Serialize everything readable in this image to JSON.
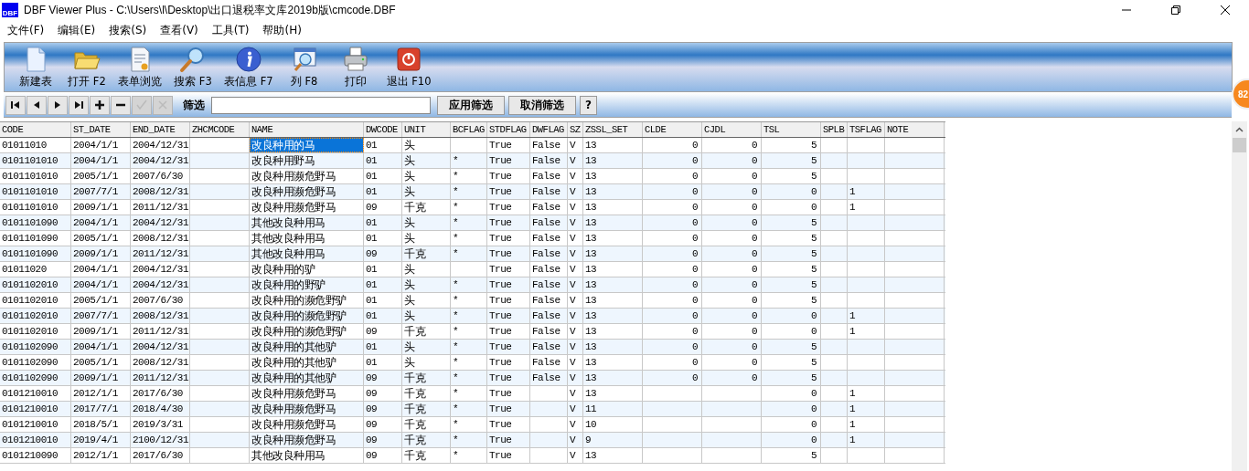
{
  "window": {
    "icon_text": "DBF",
    "title": "DBF Viewer Plus - C:\\Users\\l\\Desktop\\出口退税率文库2019b版\\cmcode.DBF"
  },
  "menu": [
    "文件(F)",
    "编辑(E)",
    "搜索(S)",
    "查看(V)",
    "工具(T)",
    "帮助(H)"
  ],
  "toolbar": [
    "新建表",
    "打开 F2",
    "表单浏览",
    "搜索 F3",
    "表信息 F7",
    "列 F8",
    "打印",
    "退出 F10"
  ],
  "navigator": [
    {
      "disabled": false
    },
    {
      "disabled": false
    },
    {
      "disabled": false
    },
    {
      "disabled": false
    },
    {
      "disabled": false
    },
    {
      "disabled": false
    },
    {
      "disabled": true
    },
    {
      "disabled": true
    }
  ],
  "filter": {
    "label": "筛选",
    "apply": "应用筛选",
    "clear": "取消筛选",
    "help": "?"
  },
  "badge": "82",
  "table": {
    "columns": [
      {
        "name": "CODE",
        "kind": "text"
      },
      {
        "name": "ST_DATE",
        "kind": "text"
      },
      {
        "name": "END_DATE",
        "kind": "text"
      },
      {
        "name": "ZHCMCODE",
        "kind": "text"
      },
      {
        "name": "NAME",
        "kind": "text"
      },
      {
        "name": "DWCODE",
        "kind": "text"
      },
      {
        "name": "UNIT",
        "kind": "text"
      },
      {
        "name": "BCFLAG",
        "kind": "text"
      },
      {
        "name": "STDFLAG",
        "kind": "text"
      },
      {
        "name": "DWFLAG",
        "kind": "text"
      },
      {
        "name": "SZ",
        "kind": "text"
      },
      {
        "name": "ZSSL_SET",
        "kind": "text"
      },
      {
        "name": "CLDE",
        "kind": "number"
      },
      {
        "name": "CJDL",
        "kind": "number"
      },
      {
        "name": "TSL",
        "kind": "number"
      },
      {
        "name": "SPLB",
        "kind": "text"
      },
      {
        "name": "TSFLAG",
        "kind": "text"
      },
      {
        "name": "NOTE",
        "kind": "text"
      }
    ],
    "rows": [
      {
        "selected": true,
        "cells": [
          "01011010",
          "2004/1/1",
          "2004/12/31",
          null,
          "改良种用的马",
          "01",
          "头",
          null,
          "True",
          "False",
          "V",
          "13",
          "0",
          "0",
          "5",
          null,
          null,
          null
        ]
      },
      {
        "selected": false,
        "cells": [
          "0101101010",
          "2004/1/1",
          "2004/12/31",
          null,
          "改良种用野马",
          "01",
          "头",
          "*",
          "True",
          "False",
          "V",
          "13",
          "0",
          "0",
          "5",
          null,
          null,
          null
        ]
      },
      {
        "selected": false,
        "cells": [
          "0101101010",
          "2005/1/1",
          "2007/6/30",
          null,
          "改良种用濒危野马",
          "01",
          "头",
          "*",
          "True",
          "False",
          "V",
          "13",
          "0",
          "0",
          "5",
          null,
          null,
          null
        ]
      },
      {
        "selected": false,
        "cells": [
          "0101101010",
          "2007/7/1",
          "2008/12/31",
          null,
          "改良种用濒危野马",
          "01",
          "头",
          "*",
          "True",
          "False",
          "V",
          "13",
          "0",
          "0",
          "0",
          null,
          "1",
          null
        ]
      },
      {
        "selected": false,
        "cells": [
          "0101101010",
          "2009/1/1",
          "2011/12/31",
          null,
          "改良种用濒危野马",
          "09",
          "千克",
          "*",
          "True",
          "False",
          "V",
          "13",
          "0",
          "0",
          "0",
          null,
          "1",
          null
        ]
      },
      {
        "selected": false,
        "cells": [
          "0101101090",
          "2004/1/1",
          "2004/12/31",
          null,
          "其他改良种用马",
          "01",
          "头",
          "*",
          "True",
          "False",
          "V",
          "13",
          "0",
          "0",
          "5",
          null,
          null,
          null
        ]
      },
      {
        "selected": false,
        "cells": [
          "0101101090",
          "2005/1/1",
          "2008/12/31",
          null,
          "其他改良种用马",
          "01",
          "头",
          "*",
          "True",
          "False",
          "V",
          "13",
          "0",
          "0",
          "5",
          null,
          null,
          null
        ]
      },
      {
        "selected": false,
        "cells": [
          "0101101090",
          "2009/1/1",
          "2011/12/31",
          null,
          "其他改良种用马",
          "09",
          "千克",
          "*",
          "True",
          "False",
          "V",
          "13",
          "0",
          "0",
          "5",
          null,
          null,
          null
        ]
      },
      {
        "selected": false,
        "cells": [
          "01011020",
          "2004/1/1",
          "2004/12/31",
          null,
          "改良种用的驴",
          "01",
          "头",
          null,
          "True",
          "False",
          "V",
          "13",
          "0",
          "0",
          "5",
          null,
          null,
          null
        ]
      },
      {
        "selected": false,
        "cells": [
          "0101102010",
          "2004/1/1",
          "2004/12/31",
          null,
          "改良种用的野驴",
          "01",
          "头",
          "*",
          "True",
          "False",
          "V",
          "13",
          "0",
          "0",
          "5",
          null,
          null,
          null
        ]
      },
      {
        "selected": false,
        "cells": [
          "0101102010",
          "2005/1/1",
          "2007/6/30",
          null,
          "改良种用的濒危野驴",
          "01",
          "头",
          "*",
          "True",
          "False",
          "V",
          "13",
          "0",
          "0",
          "5",
          null,
          null,
          null
        ]
      },
      {
        "selected": false,
        "cells": [
          "0101102010",
          "2007/7/1",
          "2008/12/31",
          null,
          "改良种用的濒危野驴",
          "01",
          "头",
          "*",
          "True",
          "False",
          "V",
          "13",
          "0",
          "0",
          "0",
          null,
          "1",
          null
        ]
      },
      {
        "selected": false,
        "cells": [
          "0101102010",
          "2009/1/1",
          "2011/12/31",
          null,
          "改良种用的濒危野驴",
          "09",
          "千克",
          "*",
          "True",
          "False",
          "V",
          "13",
          "0",
          "0",
          "0",
          null,
          "1",
          null
        ]
      },
      {
        "selected": false,
        "cells": [
          "0101102090",
          "2004/1/1",
          "2004/12/31",
          null,
          "改良种用的其他驴",
          "01",
          "头",
          "*",
          "True",
          "False",
          "V",
          "13",
          "0",
          "0",
          "5",
          null,
          null,
          null
        ]
      },
      {
        "selected": false,
        "cells": [
          "0101102090",
          "2005/1/1",
          "2008/12/31",
          null,
          "改良种用的其他驴",
          "01",
          "头",
          "*",
          "True",
          "False",
          "V",
          "13",
          "0",
          "0",
          "5",
          null,
          null,
          null
        ]
      },
      {
        "selected": false,
        "cells": [
          "0101102090",
          "2009/1/1",
          "2011/12/31",
          null,
          "改良种用的其他驴",
          "09",
          "千克",
          "*",
          "True",
          "False",
          "V",
          "13",
          "0",
          "0",
          "5",
          null,
          null,
          null
        ]
      },
      {
        "selected": false,
        "cells": [
          "0101210010",
          "2012/1/1",
          "2017/6/30",
          null,
          "改良种用濒危野马",
          "09",
          "千克",
          "*",
          "True",
          null,
          "V",
          "13",
          null,
          null,
          "0",
          null,
          "1",
          null
        ]
      },
      {
        "selected": false,
        "cells": [
          "0101210010",
          "2017/7/1",
          "2018/4/30",
          null,
          "改良种用濒危野马",
          "09",
          "千克",
          "*",
          "True",
          null,
          "V",
          "11",
          null,
          null,
          "0",
          null,
          "1",
          null
        ]
      },
      {
        "selected": false,
        "cells": [
          "0101210010",
          "2018/5/1",
          "2019/3/31",
          null,
          "改良种用濒危野马",
          "09",
          "千克",
          "*",
          "True",
          null,
          "V",
          "10",
          null,
          null,
          "0",
          null,
          "1",
          null
        ]
      },
      {
        "selected": false,
        "cells": [
          "0101210010",
          "2019/4/1",
          "2100/12/31",
          null,
          "改良种用濒危野马",
          "09",
          "千克",
          "*",
          "True",
          null,
          "V",
          "9",
          null,
          null,
          "0",
          null,
          "1",
          null
        ]
      },
      {
        "selected": false,
        "cells": [
          "0101210090",
          "2012/1/1",
          "2017/6/30",
          null,
          "其他改良种用马",
          "09",
          "千克",
          "*",
          "True",
          null,
          "V",
          "13",
          null,
          null,
          "5",
          null,
          null,
          null
        ]
      }
    ]
  }
}
